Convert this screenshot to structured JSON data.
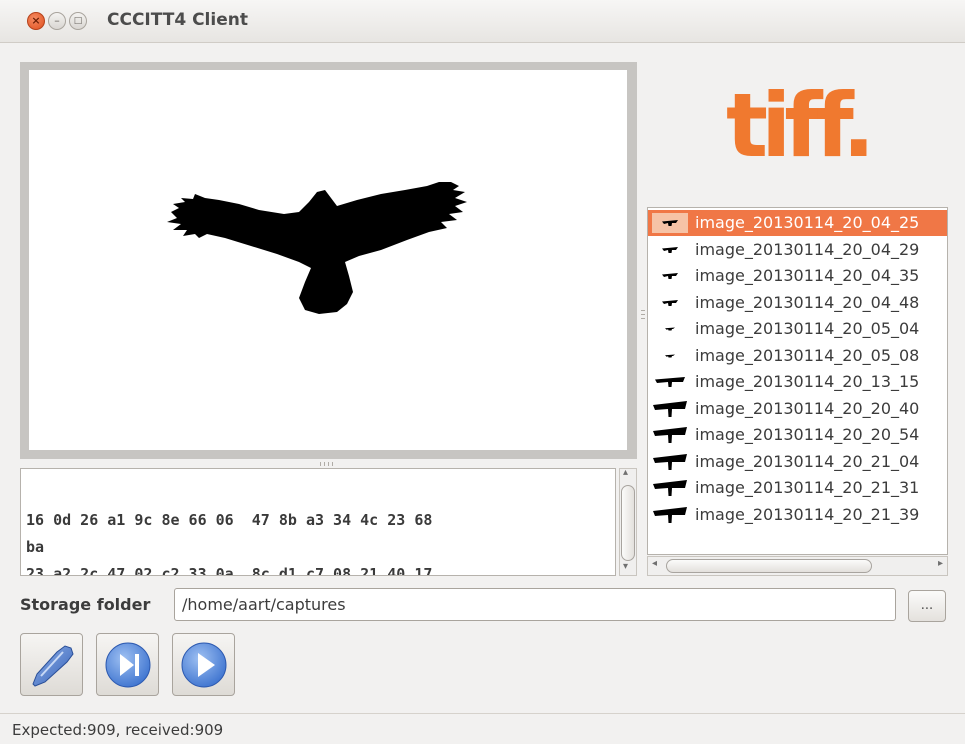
{
  "window": {
    "title": "CCCITT4 Client",
    "buttons": {
      "close": "×",
      "minimize": "–",
      "maximize": "□"
    }
  },
  "logo": {
    "text": "tiff.",
    "color": "#f0792f"
  },
  "hex_dump": {
    "lines": [
      "16 0d 26 a1 9c 8e 66 06  47 8b a3 34 4c 23 68",
      "ba",
      "23 a2 2c 47 02 c2 33 0a  8c d1 c7 08 21 40 17"
    ]
  },
  "file_list": {
    "selected_index": 0,
    "accent": "#f07746",
    "items": [
      {
        "label": "image_20130114_20_04_25",
        "thumb": "tiny"
      },
      {
        "label": "image_20130114_20_04_29",
        "thumb": "tiny"
      },
      {
        "label": "image_20130114_20_04_35",
        "thumb": "tiny"
      },
      {
        "label": "image_20130114_20_04_48",
        "thumb": "tiny"
      },
      {
        "label": "image_20130114_20_05_04",
        "thumb": "dot"
      },
      {
        "label": "image_20130114_20_05_08",
        "thumb": "dot"
      },
      {
        "label": "image_20130114_20_13_15",
        "thumb": "medium"
      },
      {
        "label": "image_20130114_20_20_40",
        "thumb": "large"
      },
      {
        "label": "image_20130114_20_20_54",
        "thumb": "large"
      },
      {
        "label": "image_20130114_20_21_04",
        "thumb": "large"
      },
      {
        "label": "image_20130114_20_21_31",
        "thumb": "large"
      },
      {
        "label": "image_20130114_20_21_39",
        "thumb": "large"
      }
    ]
  },
  "storage": {
    "label": "Storage folder",
    "path": "/home/aart/captures",
    "browse_label": "..."
  },
  "toolbar": {
    "buttons": [
      {
        "name": "connect-button",
        "icon": "plug-icon"
      },
      {
        "name": "step-button",
        "icon": "skip-next-icon"
      },
      {
        "name": "play-button",
        "icon": "play-icon"
      }
    ]
  },
  "status": {
    "text": "Expected:909, received:909"
  }
}
